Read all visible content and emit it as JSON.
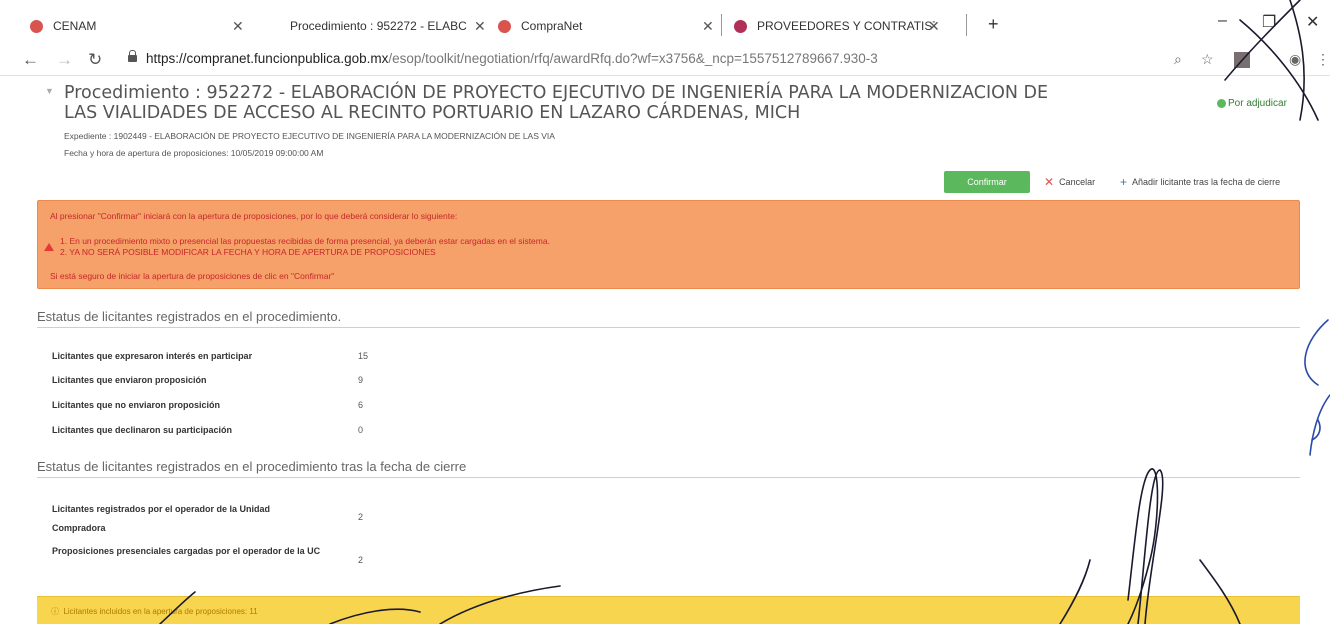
{
  "browser": {
    "tabs": [
      {
        "title": "CENAM",
        "favicon_color": "#d9534f"
      },
      {
        "title": "Procedimiento : 952272 - ELABC",
        "favicon_color": ""
      },
      {
        "title": "CompraNet",
        "favicon_color": "#d9534f"
      },
      {
        "title": "PROVEEDORES Y CONTRATISTAS",
        "favicon_color": "#b0305a"
      }
    ],
    "new_tab": "+",
    "url_host": "https://compranet.funcionpublica.gob.mx",
    "url_path": "/esop/toolkit/negotiation/rfq/awardRfq.do?wf=x3756&_ncp=1557512789667.930-3"
  },
  "header": {
    "title": "Procedimiento : 952272 - ELABORACIÓN DE PROYECTO EJECUTIVO DE INGENIERÍA PARA LA MODERNIZACION DE LAS VIALIDADES DE ACCESO AL RECINTO PORTUARIO EN LAZARO CÁRDENAS, MICH",
    "status": "Por adjudicar",
    "expediente": "Expediente : 1902449 - ELABORACIÓN DE PROYECTO EJECUTIVO DE INGENIERÍA PARA LA MODERNIZACIÓN DE LAS VIA",
    "fecha": "Fecha y hora de apertura de proposiciones: 10/05/2019 09:00:00 AM"
  },
  "toolbar": {
    "confirm_label": "Confirmar",
    "cancel_label": "Cancelar",
    "add_label": "Añadir licitante tras la fecha de cierre"
  },
  "warning": {
    "intro": "Al presionar \"Confirmar\" iniciará con la apertura de proposiciones, por lo que deberá considerar lo siguiente:",
    "item1": "1. En un procedimiento mixto o presencial las propuestas recibidas de forma presencial, ya deberán estar cargadas en el sistema.",
    "item2": "2. YA NO SERÁ POSIBLE MODIFICAR LA FECHA Y HORA DE APERTURA DE PROPOSICIONES",
    "outro": "Si está seguro de iniciar la apertura de proposiciones de clic en \"Confirmar\""
  },
  "section1": {
    "title": "Estatus de licitantes registrados en el procedimiento.",
    "rows": [
      {
        "label": "Licitantes que expresaron interés en participar",
        "value": "15"
      },
      {
        "label": "Licitantes que enviaron proposición",
        "value": "9"
      },
      {
        "label": "Licitantes que no enviaron proposición",
        "value": "6"
      },
      {
        "label": "Licitantes que declinaron su participación",
        "value": "0"
      }
    ]
  },
  "section2": {
    "title": "Estatus de licitantes registrados en el procedimiento tras la fecha de cierre",
    "rows": [
      {
        "label": "Licitantes registrados por el operador de la Unidad Compradora",
        "value": "2"
      },
      {
        "label": "Proposiciones presenciales cargadas por el operador de la UC",
        "value": "2"
      }
    ]
  },
  "info_banner": "Licitantes incluidos en la apertura de proposiciones: 11"
}
